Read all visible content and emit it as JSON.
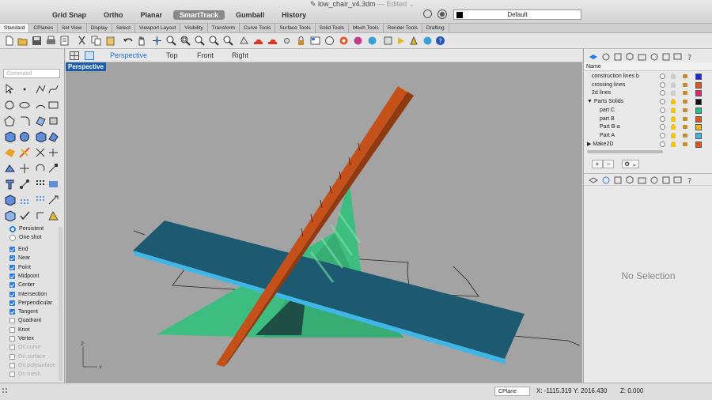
{
  "title": {
    "filename": "low_chair_v4.3dm",
    "status": "— Edited ⌄"
  },
  "topmenu": [
    "Grid Snap",
    "Ortho",
    "Planar",
    "SmartTrack",
    "Gumball",
    "History"
  ],
  "topmenu_active": "SmartTrack",
  "layer_dropdown": "Default",
  "toolbar_tabs": [
    "Standard",
    "CPlanes",
    "Set View",
    "Display",
    "Select",
    "Viewport Layout",
    "Visibility",
    "Transform",
    "Curve Tools",
    "Surface Tools",
    "Solid Tools",
    "Mesh Tools",
    "Render Tools",
    "Drafting"
  ],
  "command_placeholder": "Command",
  "viewport_tabs": [
    "Perspective",
    "Top",
    "Front",
    "Right"
  ],
  "viewport_label": "Perspective",
  "osnap": {
    "persistent": "Persistent",
    "one_shot": "One shot",
    "items": [
      {
        "label": "End",
        "checked": true,
        "enabled": true
      },
      {
        "label": "Near",
        "checked": true,
        "enabled": true
      },
      {
        "label": "Point",
        "checked": true,
        "enabled": true
      },
      {
        "label": "Midpoint",
        "checked": true,
        "enabled": true
      },
      {
        "label": "Center",
        "checked": true,
        "enabled": true
      },
      {
        "label": "Intersection",
        "checked": true,
        "enabled": true
      },
      {
        "label": "Perpendicular",
        "checked": true,
        "enabled": true
      },
      {
        "label": "Tangent",
        "checked": true,
        "enabled": true
      },
      {
        "label": "Quadrant",
        "checked": false,
        "enabled": true
      },
      {
        "label": "Knot",
        "checked": false,
        "enabled": true
      },
      {
        "label": "Vertex",
        "checked": false,
        "enabled": true
      },
      {
        "label": "On curve",
        "checked": false,
        "enabled": false
      },
      {
        "label": "On surface",
        "checked": false,
        "enabled": false
      },
      {
        "label": "On polysurface",
        "checked": false,
        "enabled": false
      },
      {
        "label": "On mesh",
        "checked": false,
        "enabled": false
      }
    ]
  },
  "layers": {
    "header": "Name",
    "rows": [
      {
        "name": "construction lines b",
        "indent": 1,
        "color": "#1a2bd8",
        "bulb": "#cccccc"
      },
      {
        "name": "crossing lines",
        "indent": 1,
        "color": "#e0531a",
        "bulb": "#cccccc"
      },
      {
        "name": "2d lines",
        "indent": 1,
        "color": "#e0236a",
        "bulb": "#cccccc"
      },
      {
        "name": "▼ Parts Solids",
        "indent": 0,
        "color": "#111111",
        "bulb": "#f2c218"
      },
      {
        "name": "part C",
        "indent": 2,
        "color": "#1fc489",
        "bulb": "#f2c218"
      },
      {
        "name": "part B",
        "indent": 2,
        "color": "#e0531a",
        "bulb": "#f2c218"
      },
      {
        "name": "Part B-a",
        "indent": 2,
        "color": "#e8b81e",
        "bulb": "#f2c218"
      },
      {
        "name": "Part A",
        "indent": 2,
        "color": "#3fb6e8",
        "bulb": "#f2c218"
      },
      {
        "name": "▶ Make2D",
        "indent": 0,
        "color": "#e0531a",
        "bulb": "#f2c218"
      }
    ],
    "add_button": "+",
    "remove_button": "−",
    "gear_button": "⚙ ⌄"
  },
  "properties": {
    "empty_text": "No Selection"
  },
  "status": {
    "cplane": "CPlane",
    "x": "X: -1115.319",
    "y": "Y: 2016.430",
    "z": "Z: 0.000"
  },
  "axis": {
    "x": "Y",
    "z": "Z"
  },
  "colors": {
    "accent": "#1d6fd6",
    "viewport_bg": "#a3a3a3",
    "board": "#1d5a72",
    "board_edge": "#3fb6e8",
    "plank": "#c4511a",
    "triangle": "#3dbd80"
  }
}
